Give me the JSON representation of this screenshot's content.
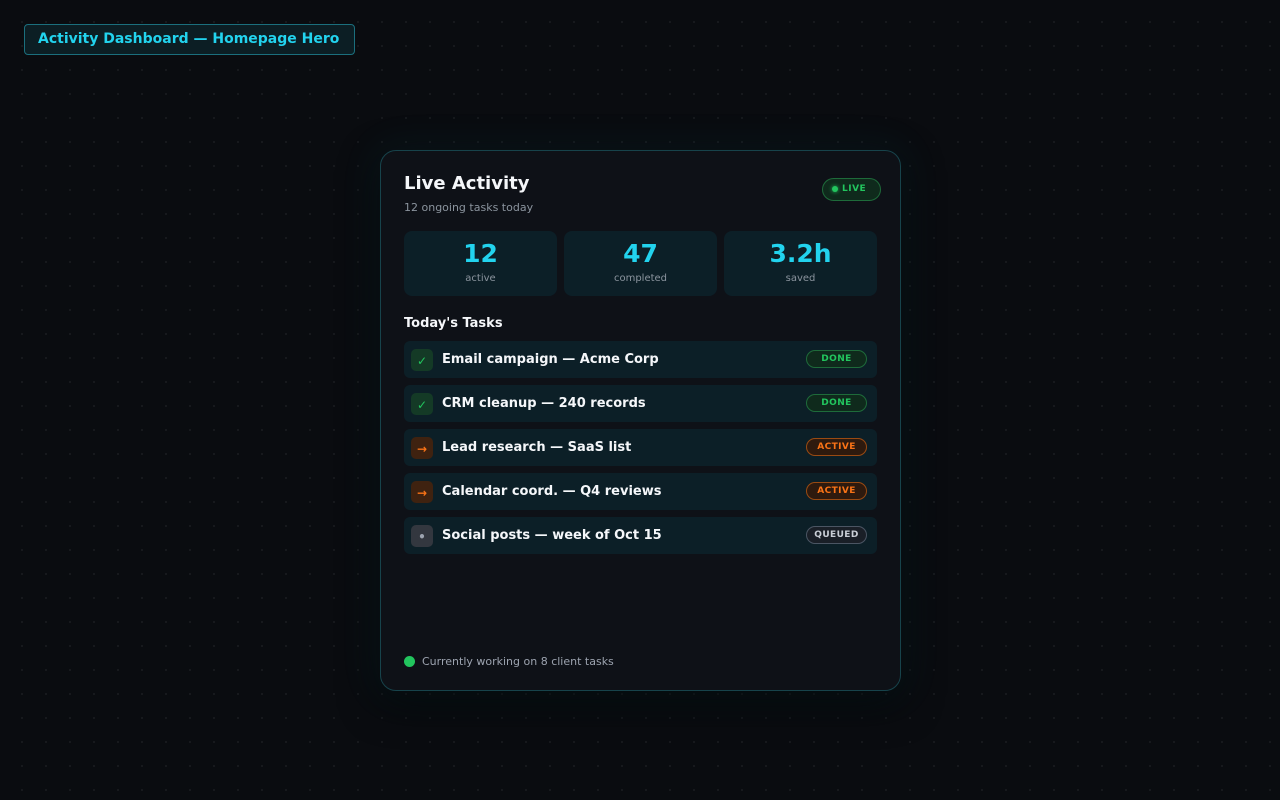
{
  "page_tag": "Activity Dashboard — Homepage Hero",
  "card": {
    "title": "Live Activity",
    "subtitle": "12 ongoing tasks today",
    "live_badge": "LIVE"
  },
  "stats": [
    {
      "value": "12",
      "label": "active"
    },
    {
      "value": "47",
      "label": "completed"
    },
    {
      "value": "3.2h",
      "label": "saved"
    }
  ],
  "tasks_section": {
    "title": "Today's Tasks",
    "tasks": [
      {
        "icon": "✓",
        "icon_name": "check-icon",
        "label": "Email campaign — Acme Corp",
        "status": "DONE"
      },
      {
        "icon": "✓",
        "icon_name": "check-icon",
        "label": "CRM cleanup — 240 records",
        "status": "DONE"
      },
      {
        "icon": "→",
        "icon_name": "arrow-right-icon",
        "label": "Lead research — SaaS list",
        "status": "ACTIVE"
      },
      {
        "icon": "→",
        "icon_name": "arrow-right-icon",
        "label": "Calendar coord. — Q4 reviews",
        "status": "ACTIVE"
      },
      {
        "icon": "•",
        "icon_name": "dot-icon",
        "label": "Social posts — week of Oct 15",
        "status": "QUEUED"
      }
    ]
  },
  "footer": {
    "text": "Currently working on 8 client tasks"
  },
  "colors": {
    "accent": "#22d3ee",
    "done": "#22c55e",
    "active": "#f97316",
    "queued": "#9ca3af",
    "background": "#0a0c10",
    "card": "#0e1117"
  }
}
